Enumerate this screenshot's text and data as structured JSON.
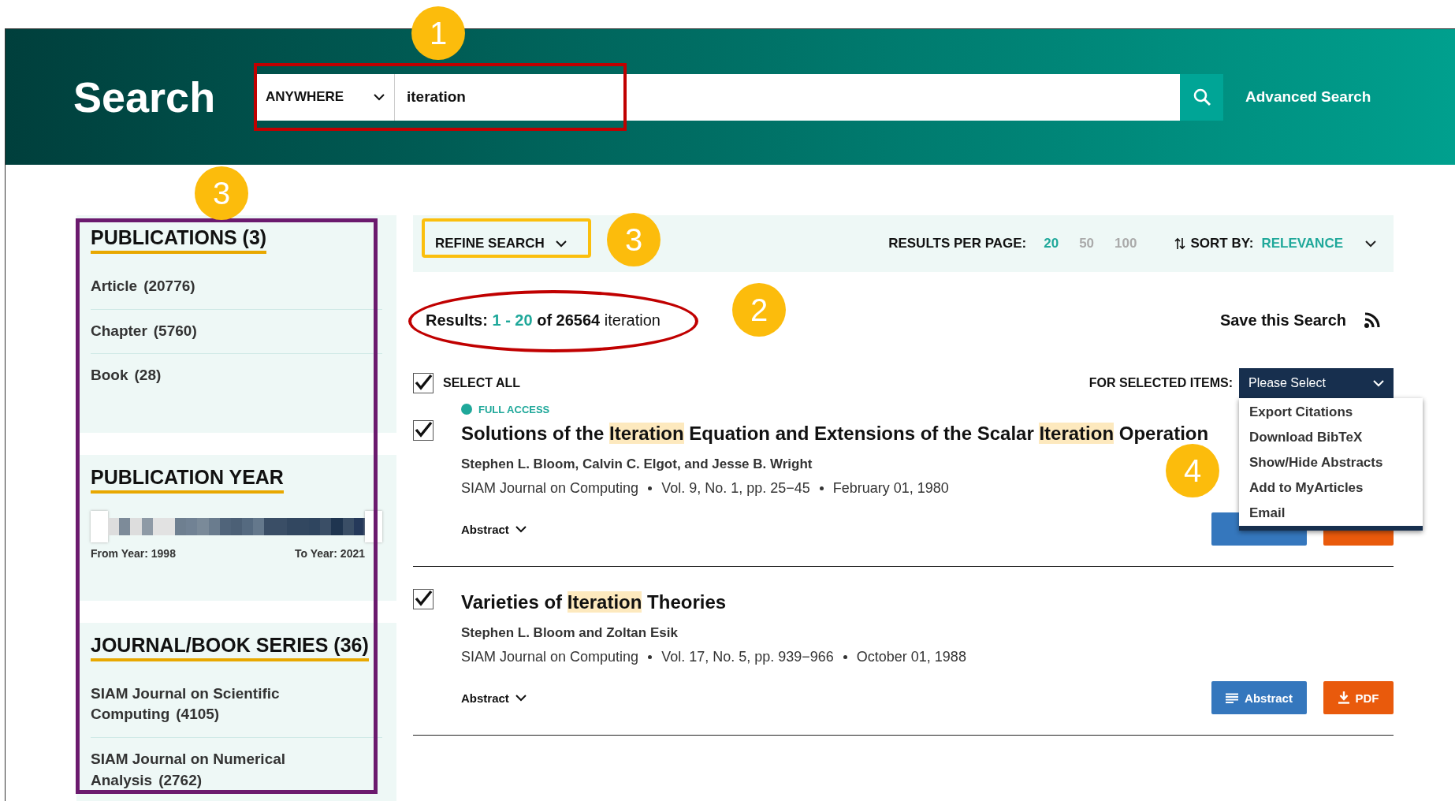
{
  "header": {
    "title": "Search",
    "scope": "ANYWHERE",
    "query": "iteration",
    "advanced_link": "Advanced Search"
  },
  "sidebar": {
    "sections": [
      {
        "kind": "list",
        "heading": "PUBLICATIONS (3)",
        "items": [
          {
            "name": "Article",
            "count": "(20776)"
          },
          {
            "name": "Chapter",
            "count": "(5760)"
          },
          {
            "name": "Book",
            "count": "(28)"
          }
        ]
      },
      {
        "kind": "range",
        "heading": "PUBLICATION YEAR",
        "from": "From Year: 1998",
        "to": "To Year: 2021"
      },
      {
        "kind": "list",
        "heading": "JOURNAL/BOOK SERIES (36)",
        "items": [
          {
            "name": "SIAM Journal on Scientific Computing",
            "count": "(4105)"
          },
          {
            "name": "SIAM Journal on Numerical Analysis",
            "count": "(2762)"
          }
        ]
      }
    ]
  },
  "toolbar": {
    "refine": "REFINE SEARCH",
    "per_page_label": "RESULTS PER PAGE:",
    "per_page": [
      {
        "label": "20",
        "selected": true
      },
      {
        "label": "50",
        "selected": false
      },
      {
        "label": "100",
        "selected": false
      }
    ],
    "sort_label": "SORT BY:",
    "sort_value": "RELEVANCE"
  },
  "summary": {
    "parts": [
      {
        "text": "Results: ",
        "kind": "label"
      },
      {
        "text": "1 - 20",
        "kind": "range"
      },
      {
        "text": " of 26564",
        "kind": "total"
      },
      {
        "text": " iteration",
        "kind": "query"
      }
    ],
    "save": "Save this Search"
  },
  "select_all": {
    "label": "SELECT ALL",
    "checked": true
  },
  "bulk": {
    "label": "FOR SELECTED ITEMS:",
    "value": "Please Select",
    "expanded": true,
    "options": [
      "Export Citations",
      "Download BibTeX",
      "Show/Hide Abstracts",
      "Add to MyArticles",
      "Email"
    ]
  },
  "results": [
    {
      "access": "FULL ACCESS",
      "checked": true,
      "title_parts": [
        {
          "text": "Solutions of the ",
          "highlighted": false
        },
        {
          "text": "Iteration",
          "highlighted": true
        },
        {
          "text": " Equation and Extensions of the Scalar ",
          "highlighted": false
        },
        {
          "text": "Iteration",
          "highlighted": true
        },
        {
          "text": " Operation",
          "highlighted": false
        }
      ],
      "authors": "Stephen L. Bloom, Calvin C. Elgot, and Jesse B. Wright",
      "source": "SIAM Journal on Computing",
      "volume": "Vol. 9, No. 1, pp. 25−45",
      "date": "February 01, 1980",
      "abstract_toggle": "Abstract"
    },
    {
      "checked": true,
      "title_parts": [
        {
          "text": "Varieties of ",
          "highlighted": false
        },
        {
          "text": "Iteration",
          "highlighted": true
        },
        {
          "text": " Theories",
          "highlighted": false
        }
      ],
      "authors": "Stephen L. Bloom and Zoltan Esik",
      "source": "SIAM Journal on Computing",
      "volume": "Vol. 17, No. 5, pp. 939−966",
      "date": "October 01, 1988",
      "abstract_toggle": "Abstract",
      "abstract_button": "Abstract",
      "pdf_button": "PDF"
    }
  ],
  "callouts": [
    "1",
    "3",
    "3",
    "2",
    "4"
  ]
}
